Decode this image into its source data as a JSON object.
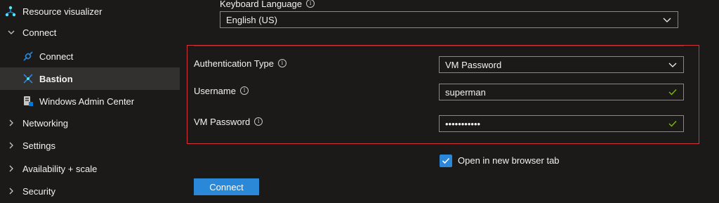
{
  "sidebar": {
    "items": [
      {
        "label": "Resource visualizer",
        "icon": "resource-visualizer-icon"
      },
      {
        "label": "Connect",
        "icon": "chevron-down-icon",
        "expanded": true
      },
      {
        "label": "Connect",
        "icon": "connect-plug-icon"
      },
      {
        "label": "Bastion",
        "icon": "bastion-icon",
        "active": true
      },
      {
        "label": "Windows Admin Center",
        "icon": "windows-admin-center-icon"
      },
      {
        "label": "Networking",
        "icon": "chevron-right-icon"
      },
      {
        "label": "Settings",
        "icon": "chevron-right-icon"
      },
      {
        "label": "Availability + scale",
        "icon": "chevron-right-icon"
      },
      {
        "label": "Security",
        "icon": "chevron-right-icon"
      }
    ]
  },
  "form": {
    "keyboard_language": {
      "label": "Keyboard Language",
      "value": "English (US)"
    },
    "auth_type": {
      "label": "Authentication Type",
      "value": "VM Password"
    },
    "username": {
      "label": "Username",
      "value": "superman"
    },
    "password": {
      "label": "VM Password",
      "value": "•••••••••••"
    },
    "open_new_tab": {
      "label": "Open in new browser tab",
      "checked": true
    },
    "connect_button": "Connect"
  },
  "colors": {
    "background": "#1b1a19",
    "active_nav": "#323130",
    "accent": "#2b88d8",
    "highlight_border": "#d13438",
    "valid_check": "#7fba00"
  }
}
